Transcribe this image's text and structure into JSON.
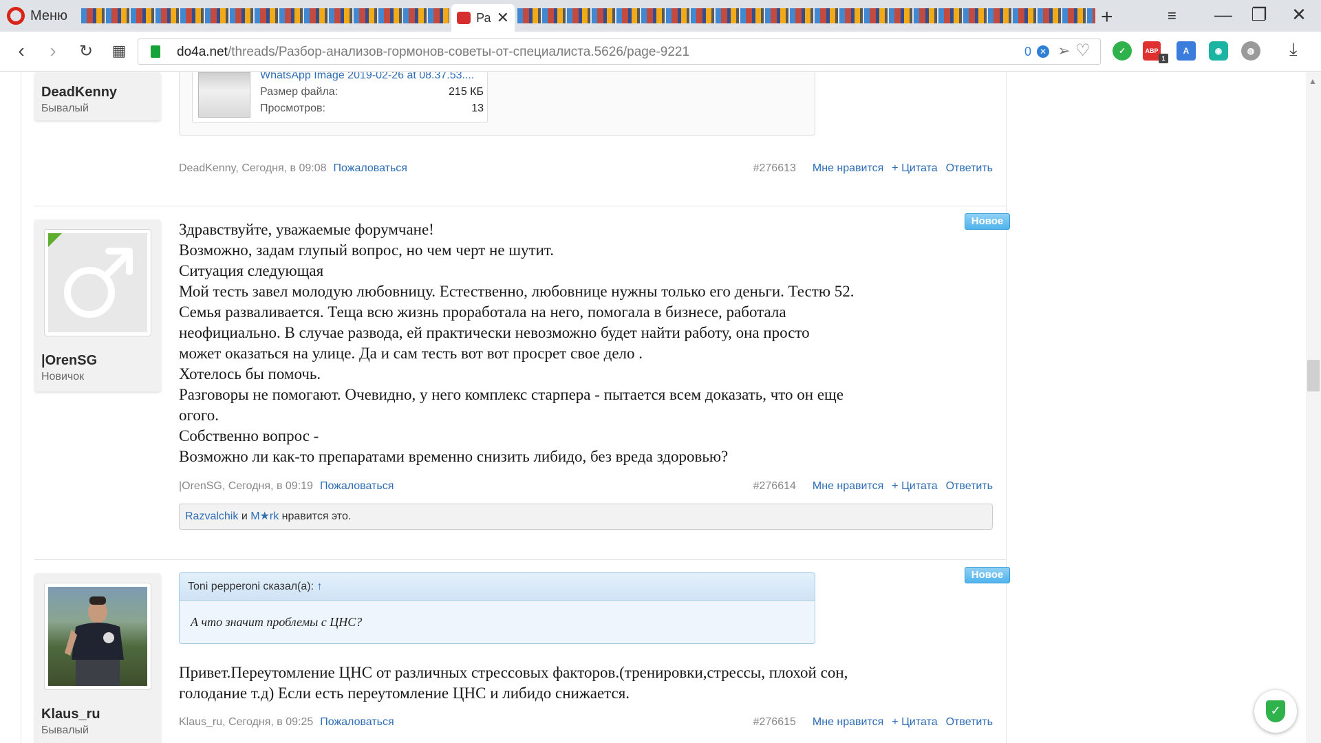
{
  "browser": {
    "menu_label": "Меню",
    "active_tab_label": "Ра",
    "url_domain": "do4a.net",
    "url_path": "/threads/Разбор-анализов-гормонов-советы-от-специалиста.5626/page-9221",
    "address_badge_count": "0",
    "extensions": [
      "check-icon",
      "adblock-icon",
      "translate-icon",
      "vpn-icon",
      "globe-icon"
    ],
    "adblock_count": "1",
    "colors": {
      "tabbar": "#dfe3e8",
      "opera_red": "#d9241a",
      "link_blue": "#2f6db5",
      "ssl_green": "#18a23a"
    }
  },
  "posts": [
    {
      "username": "DeadKenny",
      "usertitle": "Бывалый",
      "attachment": {
        "name": "WhatsApp Image 2019-02-26 at 08.37.53....",
        "size_label": "Размер файла:",
        "size_value": "215 КБ",
        "views_label": "Просмотров:",
        "views_value": "13"
      },
      "meta": "DeadKenny, Сегодня, в 09:08",
      "report": "Пожаловаться",
      "permalink": "#276613",
      "like": "Мне нравится",
      "quote": "+ Цитата",
      "reply": "Ответить"
    },
    {
      "username": "|OrenSG",
      "usertitle": "Новичок",
      "badge": "Новое",
      "lines": [
        "Здравствуйте, уважаемые форумчане!",
        "Возможно, задам глупый вопрос, но чем черт не шутит.",
        "Ситуация следующая",
        "Мой тесть завел молодую любовницу. Естественно, любовнице нужны только его деньги. Тестю 52.",
        "Семья разваливается. Теща всю жизнь проработала на него, помогала в бизнесе, работала",
        "неофициально. В случае развода, ей практически невозможно будет найти работу, она просто",
        "может оказаться на улице. Да и сам тесть вот вот просрет свое дело .",
        "Хотелось бы помочь.",
        "Разговоры не помогают. Очевидно, у него комплекс старпера - пытается всем доказать, что он еще",
        "огого.",
        "Собственно вопрос -",
        "Возможно ли как-то препаратами временно снизить либидо, без вреда здоровью?"
      ],
      "meta": "|OrenSG, Сегодня, в 09:19",
      "report": "Пожаловаться",
      "permalink": "#276614",
      "like": "Мне нравится",
      "quote": "+ Цитата",
      "reply": "Ответить",
      "likes": {
        "user1": "Razvalchik",
        "and": "и",
        "user2": "M★rk",
        "suffix": "нравится это."
      }
    },
    {
      "username": "Klaus_ru",
      "usertitle": "Бывалый",
      "badge": "Новое",
      "quote_block": {
        "author": "Toni pepperoni сказал(а):",
        "arrow": "↑",
        "text": "А что значит проблемы с ЦНС?"
      },
      "lines": [
        "Привет.Переутомление ЦНС от различных стрессовых факторов.(тренировки,стрессы, плохой сон,",
        "голодание т.д) Если есть переутомление ЦНС и либидо снижается."
      ],
      "meta": "Klaus_ru, Сегодня, в 09:25",
      "report": "Пожаловаться",
      "permalink": "#276615",
      "like": "Мне нравится",
      "quote": "+ Цитата",
      "reply": "Ответить"
    }
  ]
}
